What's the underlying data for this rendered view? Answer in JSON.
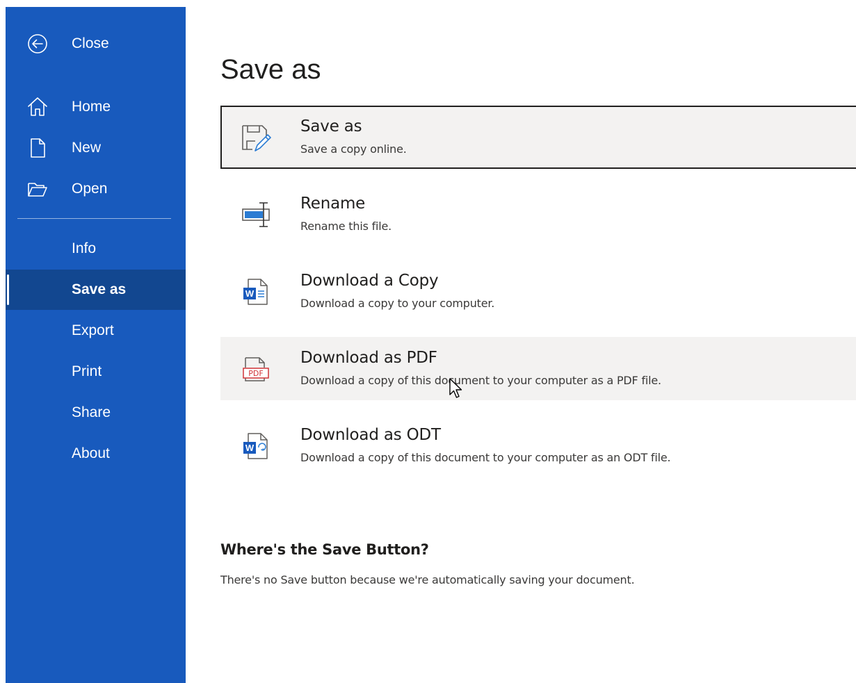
{
  "sidebar": {
    "close_label": "Close",
    "items": [
      {
        "label": "Home",
        "icon": "home-icon"
      },
      {
        "label": "New",
        "icon": "new-document-icon"
      },
      {
        "label": "Open",
        "icon": "open-folder-icon"
      },
      {
        "label": "Info"
      },
      {
        "label": "Save as"
      },
      {
        "label": "Export"
      },
      {
        "label": "Print"
      },
      {
        "label": "Share"
      },
      {
        "label": "About"
      }
    ],
    "selected_item": "Save as",
    "background_color": "#185abd",
    "selected_color": "#124790"
  },
  "main": {
    "title": "Save as",
    "options": [
      {
        "title": "Save as",
        "description": "Save a copy online.",
        "icon": "save-as-icon"
      },
      {
        "title": "Rename",
        "description": "Rename this file.",
        "icon": "rename-icon"
      },
      {
        "title": "Download a Copy",
        "description": "Download a copy to your computer.",
        "icon": "word-document-icon"
      },
      {
        "title": "Download as PDF",
        "description": "Download a copy of this document to your computer as a PDF file.",
        "icon": "pdf-icon"
      },
      {
        "title": "Download as ODT",
        "description": "Download a copy of this document to your computer as an ODT file.",
        "icon": "odt-document-icon"
      }
    ],
    "save_info": {
      "heading": "Where's the Save Button?",
      "text": "There's no Save button because we're automatically saving your document."
    }
  },
  "colors": {
    "word_blue": "#185abd",
    "pdf_red": "#d13438",
    "hover_background": "#f3f2f1"
  }
}
